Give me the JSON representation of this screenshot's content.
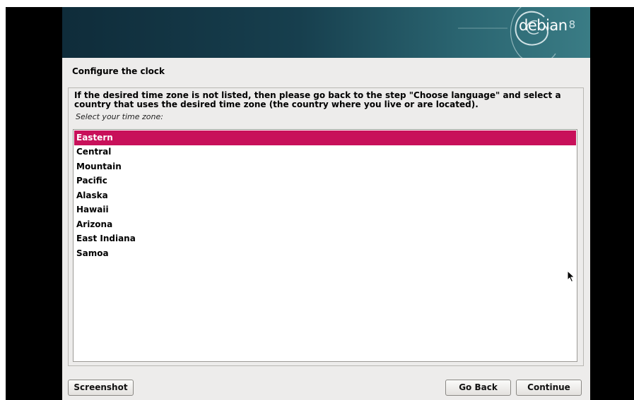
{
  "banner": {
    "logo_text": "debian",
    "logo_version": "8",
    "colors": {
      "banner_dark": "#0f2c3a",
      "banner_light": "#3a7c85"
    }
  },
  "step_title": "Configure the clock",
  "description": "If the desired time zone is not listed, then please go back to the step \"Choose language\" and select a country that uses the desired time zone (the country where you live or are located).",
  "prompt": "Select your time zone:",
  "timezones": {
    "selected": "Eastern",
    "items": [
      "Eastern",
      "Central",
      "Mountain",
      "Pacific",
      "Alaska",
      "Hawaii",
      "Arizona",
      "East Indiana",
      "Samoa"
    ]
  },
  "buttons": {
    "screenshot": "Screenshot",
    "go_back": "Go Back",
    "continue": "Continue"
  },
  "colors": {
    "selection": "#c8105a",
    "background": "#edeceb"
  },
  "icons": {
    "pointer": "mouse-pointer-icon",
    "logo_swirl": "debian-swirl-icon"
  }
}
